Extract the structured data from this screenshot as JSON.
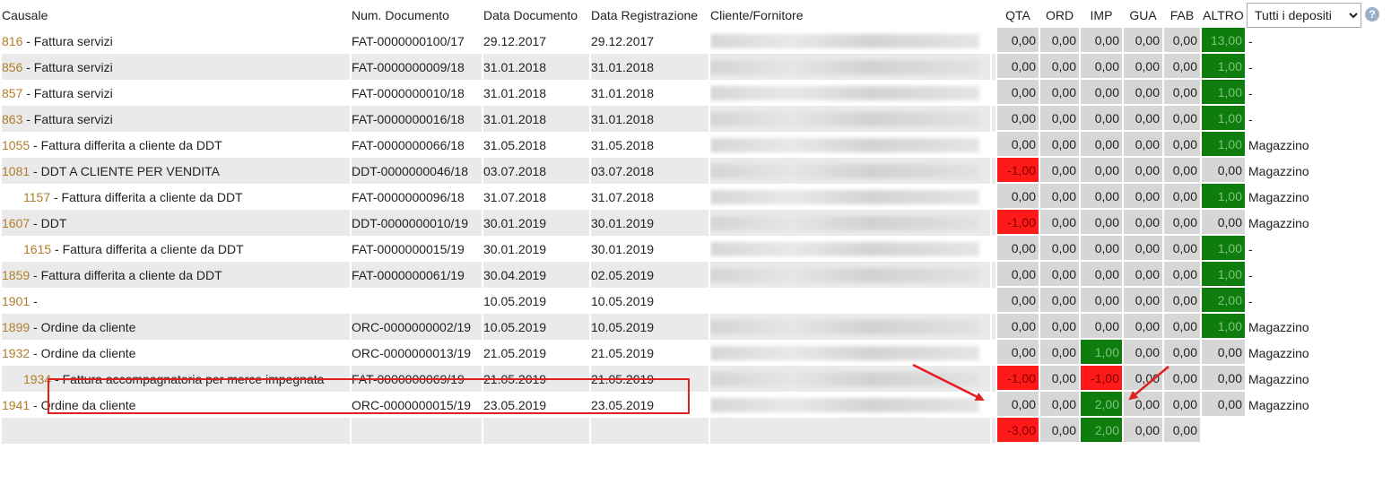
{
  "headers": {
    "causale": "Causale",
    "num_documento": "Num. Documento",
    "data_documento": "Data Documento",
    "data_registrazione": "Data Registrazione",
    "cliente_fornitore": "Cliente/Fornitore",
    "qta": "QTA",
    "ord": "ORD",
    "imp": "IMP",
    "gua": "GUA",
    "fab": "FAB",
    "altro": "ALTRO"
  },
  "depot_select": {
    "selected": "Tutti i depositi"
  },
  "help_icon": "?",
  "colors": {
    "negative": "#ff1a1a",
    "positive": "#0e7d0e",
    "neutral": "#d6d6d6",
    "code": "#b07d2a",
    "annotation": "#e02020"
  },
  "rows": [
    {
      "code": "816",
      "desc": " - Fattura servizi",
      "doc": "FAT-0000000100/17",
      "ddoc": "29.12.2017",
      "dreg": "29.12.2017",
      "qta": "0,00",
      "ord": "0,00",
      "imp": "0,00",
      "gua": "0,00",
      "fab": "0,00",
      "altro": "13,00",
      "depot": "-"
    },
    {
      "code": "856",
      "desc": " - Fattura servizi",
      "doc": "FAT-0000000009/18",
      "ddoc": "31.01.2018",
      "dreg": "31.01.2018",
      "qta": "0,00",
      "ord": "0,00",
      "imp": "0,00",
      "gua": "0,00",
      "fab": "0,00",
      "altro": "1,00",
      "depot": "-"
    },
    {
      "code": "857",
      "desc": " - Fattura servizi",
      "doc": "FAT-0000000010/18",
      "ddoc": "31.01.2018",
      "dreg": "31.01.2018",
      "qta": "0,00",
      "ord": "0,00",
      "imp": "0,00",
      "gua": "0,00",
      "fab": "0,00",
      "altro": "1,00",
      "depot": "-"
    },
    {
      "code": "863",
      "desc": " - Fattura servizi",
      "doc": "FAT-0000000016/18",
      "ddoc": "31.01.2018",
      "dreg": "31.01.2018",
      "qta": "0,00",
      "ord": "0,00",
      "imp": "0,00",
      "gua": "0,00",
      "fab": "0,00",
      "altro": "1,00",
      "depot": "-"
    },
    {
      "code": "1055",
      "desc": " - Fattura differita a cliente da DDT",
      "doc": "FAT-0000000066/18",
      "ddoc": "31.05.2018",
      "dreg": "31.05.2018",
      "qta": "0,00",
      "ord": "0,00",
      "imp": "0,00",
      "gua": "0,00",
      "fab": "0,00",
      "altro": "1,00",
      "depot": "Magazzino"
    },
    {
      "code": "1081",
      "desc": " - DDT A CLIENTE PER VENDITA",
      "doc": "DDT-0000000046/18",
      "ddoc": "03.07.2018",
      "dreg": "03.07.2018",
      "qta": "-1,00",
      "ord": "0,00",
      "imp": "0,00",
      "gua": "0,00",
      "fab": "0,00",
      "altro": "0,00",
      "depot": "Magazzino"
    },
    {
      "code": "1157",
      "desc": " - Fattura differita a cliente da DDT",
      "doc": "FAT-0000000096/18",
      "ddoc": "31.07.2018",
      "dreg": "31.07.2018",
      "qta": "0,00",
      "ord": "0,00",
      "imp": "0,00",
      "gua": "0,00",
      "fab": "0,00",
      "altro": "1,00",
      "depot": "Magazzino",
      "indent": true
    },
    {
      "code": "1607",
      "desc": " - DDT",
      "doc": "DDT-0000000010/19",
      "ddoc": "30.01.2019",
      "dreg": "30.01.2019",
      "qta": "-1,00",
      "ord": "0,00",
      "imp": "0,00",
      "gua": "0,00",
      "fab": "0,00",
      "altro": "0,00",
      "depot": "Magazzino"
    },
    {
      "code": "1615",
      "desc": " - Fattura differita a cliente da DDT",
      "doc": "FAT-0000000015/19",
      "ddoc": "30.01.2019",
      "dreg": "30.01.2019",
      "qta": "0,00",
      "ord": "0,00",
      "imp": "0,00",
      "gua": "0,00",
      "fab": "0,00",
      "altro": "1,00",
      "depot": "-",
      "indent": true
    },
    {
      "code": "1859",
      "desc": " - Fattura differita a cliente da DDT",
      "doc": "FAT-0000000061/19",
      "ddoc": "30.04.2019",
      "dreg": "02.05.2019",
      "qta": "0,00",
      "ord": "0,00",
      "imp": "0,00",
      "gua": "0,00",
      "fab": "0,00",
      "altro": "1,00",
      "depot": "-"
    },
    {
      "code": "1901",
      "desc": " -",
      "doc": "",
      "ddoc": "10.05.2019",
      "dreg": "10.05.2019",
      "qta": "0,00",
      "ord": "0,00",
      "imp": "0,00",
      "gua": "0,00",
      "fab": "0,00",
      "altro": "2,00",
      "depot": "-",
      "noclient": true
    },
    {
      "code": "1899",
      "desc": " - Ordine da cliente",
      "doc": "ORC-0000000002/19",
      "ddoc": "10.05.2019",
      "dreg": "10.05.2019",
      "qta": "0,00",
      "ord": "0,00",
      "imp": "0,00",
      "gua": "0,00",
      "fab": "0,00",
      "altro": "1,00",
      "depot": "Magazzino"
    },
    {
      "code": "1932",
      "desc": " - Ordine da cliente",
      "doc": "ORC-0000000013/19",
      "ddoc": "21.05.2019",
      "dreg": "21.05.2019",
      "qta": "0,00",
      "ord": "0,00",
      "imp": "1,00",
      "gua": "0,00",
      "fab": "0,00",
      "altro": "0,00",
      "depot": "Magazzino"
    },
    {
      "code": "1934",
      "desc": " - Fattura accompagnatoria per merce impegnata",
      "doc": "FAT-0000000069/19",
      "ddoc": "21.05.2019",
      "dreg": "21.05.2019",
      "qta": "-1,00",
      "ord": "0,00",
      "imp": "-1,00",
      "gua": "0,00",
      "fab": "0,00",
      "altro": "0,00",
      "depot": "Magazzino",
      "indent": true
    },
    {
      "code": "1941",
      "desc": " - Ordine da cliente",
      "doc": "ORC-0000000015/19",
      "ddoc": "23.05.2019",
      "dreg": "23.05.2019",
      "qta": "0,00",
      "ord": "0,00",
      "imp": "2,00",
      "gua": "0,00",
      "fab": "0,00",
      "altro": "0,00",
      "depot": "Magazzino"
    }
  ],
  "totals": {
    "qta": "-3,00",
    "ord": "0,00",
    "imp": "2,00",
    "gua": "0,00",
    "fab": "0,00"
  }
}
